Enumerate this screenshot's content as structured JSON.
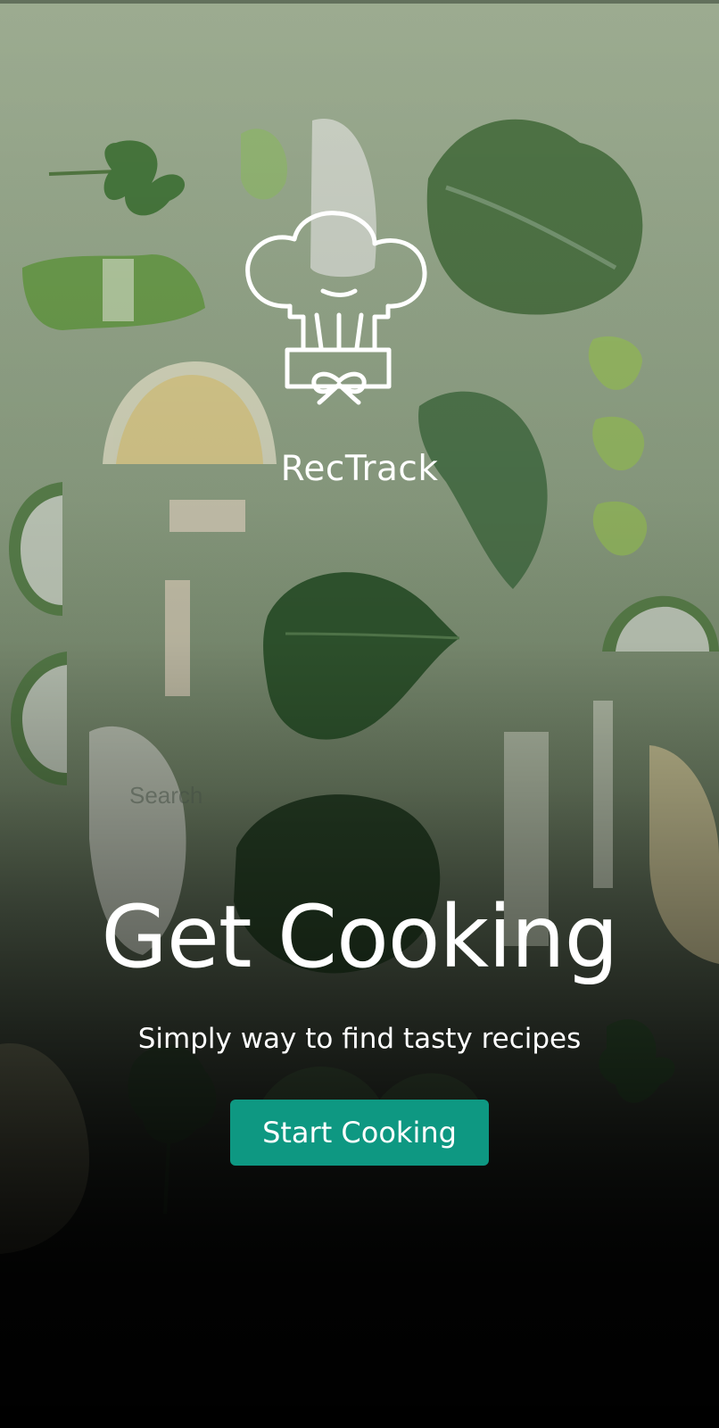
{
  "app": {
    "name": "RecTrack",
    "logo_icon": "chef-hat-icon"
  },
  "background": {
    "search_text": "Search"
  },
  "hero": {
    "headline": "Get Cooking",
    "tagline": "Simply way to find tasty recipes"
  },
  "cta": {
    "label": "Start Cooking",
    "color": "#0e9882"
  },
  "colors": {
    "text": "#ffffff",
    "background_top": "#aebfa1",
    "background_bottom": "#080808"
  }
}
